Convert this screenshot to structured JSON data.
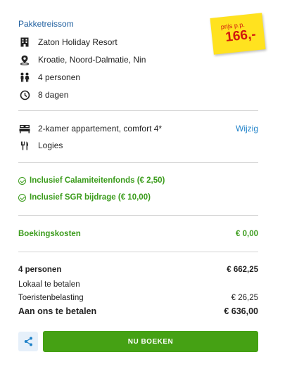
{
  "header": {
    "title": "Pakketreissom"
  },
  "price_badge": {
    "label": "prijs p.p.",
    "amount": "166,-",
    "color": "#ffe21f",
    "text_color": "#d2160f"
  },
  "details": [
    {
      "icon": "building-icon",
      "text": "Zaton Holiday Resort"
    },
    {
      "icon": "location-pin-icon",
      "text": "Kroatie, Noord-Dalmatie, Nin"
    },
    {
      "icon": "people-icon",
      "text": "4 personen"
    },
    {
      "icon": "clock-icon",
      "text": "8 dagen"
    }
  ],
  "room": {
    "icon": "bed-icon",
    "text": "2-kamer appartement, comfort 4*",
    "change_link": "Wijzig"
  },
  "board": {
    "icon": "cutlery-icon",
    "text": "Logies"
  },
  "inclusions": [
    "Inclusief Calamiteitenfonds (€ 2,50)",
    "Inclusief SGR bijdrage (€ 10,00)"
  ],
  "booking_costs": {
    "label": "Boekingskosten",
    "value": "€ 0,00"
  },
  "summary": {
    "persons_label": "4 personen",
    "persons_value": "€ 662,25",
    "local_label": "Lokaal te betalen",
    "tourist_tax_label": "Toeristenbelasting",
    "tourist_tax_value": "€ 26,25",
    "total_label": "Aan ons te betalen",
    "total_value": "€ 636,00"
  },
  "actions": {
    "share_icon": "share-icon",
    "book_label": "NU BOEKEN"
  },
  "colors": {
    "accent_blue": "#1f82c9",
    "title_blue": "#1f5f9f",
    "green": "#3b9c1c",
    "button_green": "#45a114"
  }
}
